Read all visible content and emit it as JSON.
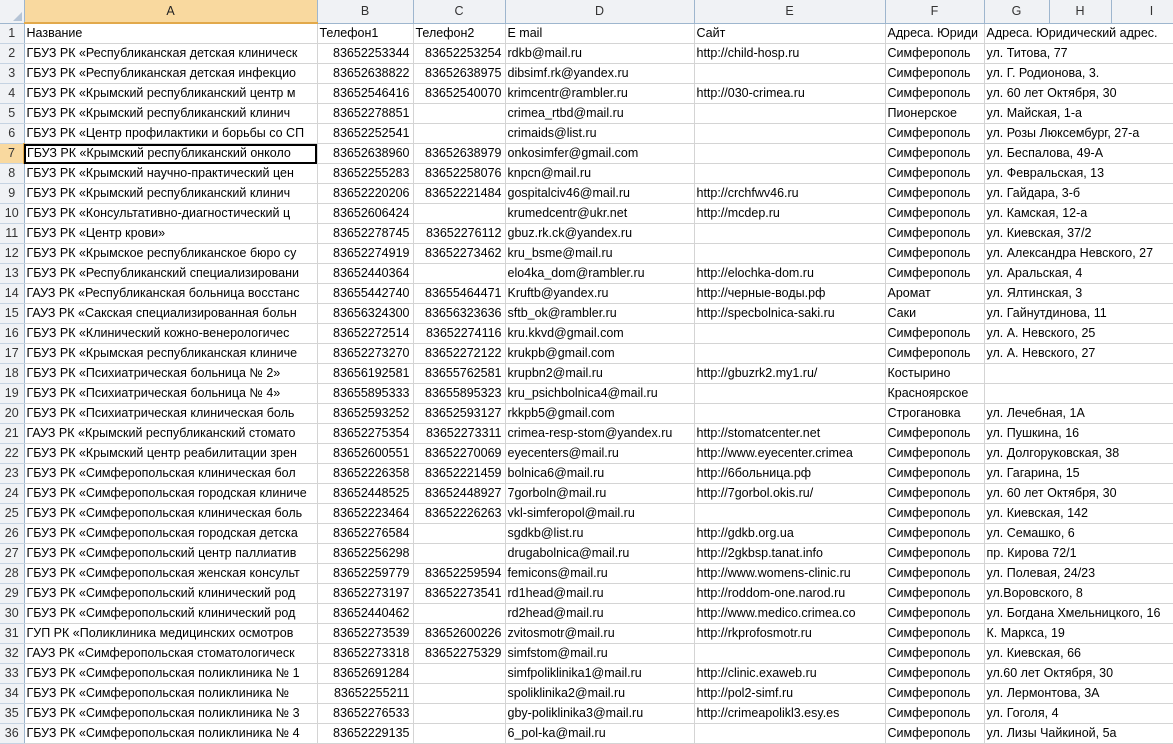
{
  "columns": [
    "A",
    "B",
    "C",
    "D",
    "E",
    "F",
    "G",
    "H",
    "I"
  ],
  "selected": {
    "row": 7,
    "col": "A"
  },
  "header_row": [
    "Название",
    "Телефон1",
    "Телефон2",
    "E mail",
    "Сайт",
    "Адреса. Юриди",
    "Адреса. Юридический адрес.",
    "",
    ""
  ],
  "rows": [
    [
      "ГБУЗ РК «Республиканская детская клиническ",
      "83652253344",
      "83652253254",
      "rdkb@mail.ru",
      "http://child-hosp.ru",
      "Симферополь",
      "ул. Титова, 77"
    ],
    [
      "ГБУЗ РК «Республиканская детская инфекцио",
      "83652638822",
      "83652638975",
      "dibsimf.rk@yandex.ru",
      "",
      "Симферополь",
      "ул. Г. Родионова, 3."
    ],
    [
      "ГБУЗ РК «Крымский республиканский центр м",
      "83652546416",
      "83652540070",
      "krimcentr@rambler.ru",
      "http://030-crimea.ru",
      "Симферополь",
      "ул. 60 лет Октября, 30"
    ],
    [
      " ГБУЗ РК «Крымский республиканский клинич",
      "83652278851",
      "",
      "crimea_rtbd@mail.ru",
      "",
      "Пионерское",
      "ул. Майская, 1-а"
    ],
    [
      "ГБУЗ РК «Центр профилактики и борьбы со СП",
      "83652252541",
      "",
      "crimaids@list.ru",
      "",
      "Симферополь",
      "ул. Розы Люксембург, 27-а"
    ],
    [
      "ГБУЗ РК «Крымский республиканский онколо",
      "83652638960",
      "83652638979",
      "onkosimfer@gmail.com",
      "",
      "Симферополь",
      " ул. Беспалова, 49-А"
    ],
    [
      "ГБУЗ РК «Крымский научно-практический цен",
      "83652255283",
      "83652258076",
      "knpcn@mail.ru",
      "",
      "Симферополь",
      "ул. Февральская, 13"
    ],
    [
      "ГБУЗ РК «Крымский республиканский клинич",
      "83652220206",
      "83652221484",
      "gospitalciv46@mail.ru",
      "http://crchfwv46.ru",
      "Симферополь",
      "ул. Гайдара, 3-б"
    ],
    [
      " ГБУЗ РК «Консультативно-диагностический ц",
      "83652606424",
      "",
      "krumedcentr@ukr.net",
      "http://mcdep.ru",
      "Симферополь",
      "ул. Камская, 12-а"
    ],
    [
      "ГБУЗ РК «Центр крови»",
      "83652278745",
      "83652276112",
      "gbuz.rk.ck@yandex.ru",
      "",
      "Симферополь",
      "ул. Киевская, 37/2"
    ],
    [
      "ГБУЗ РК «Крымское республиканское бюро су",
      "83652274919",
      "83652273462",
      "kru_bsme@mail.ru",
      "",
      "Симферополь",
      "ул. Александра Невского, 27"
    ],
    [
      "ГБУЗ РК «Республиканский специализировани",
      "83652440364",
      "",
      "elo4ka_dom@rambler.ru",
      "http://elochka-dom.ru",
      "Симферополь",
      "ул. Аральская, 4"
    ],
    [
      "ГАУЗ РК «Республиканская больница восстанс",
      "83655442740",
      "83655464471",
      "Kruftb@yandex.ru",
      "http://черные-воды.рф",
      "Аромат",
      "ул. Ялтинская, 3"
    ],
    [
      "ГАУЗ РК «Сакская специализированная больн",
      "83656324300",
      "83656323636",
      "sftb_ok@rambler.ru",
      "http://specbolnica-saki.ru",
      "Саки",
      "ул. Гайнутдинова, 11"
    ],
    [
      "ГБУЗ РК «Клинический кожно-венерологичес",
      "83652272514",
      "83652274116",
      "kru.kkvd@gmail.com",
      "",
      "Симферополь",
      "ул. А. Невского, 25"
    ],
    [
      "ГБУЗ РК «Крымская республиканская клиниче",
      "83652273270",
      "83652272122",
      "krukpb@gmail.com",
      "",
      "Симферополь",
      " ул. А. Невского, 27"
    ],
    [
      "ГБУЗ РК «Психиатрическая больница № 2»",
      "83656192581",
      "83655762581",
      "krupbn2@mail.ru",
      " http://gbuzrk2.my1.ru/",
      "Костырино",
      ""
    ],
    [
      "ГБУЗ РК «Психиатрическая больница № 4»",
      "83655895333",
      "83655895323",
      "kru_psichbolnica4@mail.ru",
      "",
      "Красноярское",
      ""
    ],
    [
      "ГБУЗ РК «Психиатрическая клиническая боль",
      "83652593252",
      "83652593127",
      "rkkpb5@gmail.com",
      "",
      "Строгановка",
      " ул. Лечебная, 1А"
    ],
    [
      "ГАУЗ РК «Крымский республиканский стомато",
      "83652275354",
      "83652273311",
      "crimea-resp-stom@yandex.ru",
      "http://stomatcenter.net",
      "Симферополь",
      "ул. Пушкина, 16"
    ],
    [
      "ГБУЗ РК «Крымский центр реабилитации зрен",
      "83652600551",
      "83652270069",
      " eyecenters@mail.ru",
      "http://www.eyecenter.crimea",
      "Симферополь",
      "ул. Долгоруковская, 38"
    ],
    [
      " ГБУЗ РК «Симферопольская клиническая бол",
      "83652226358",
      "83652221459",
      "bolnica6@mail.ru",
      "http://6больница.рф",
      "Симферополь",
      "ул. Гагарина, 15"
    ],
    [
      "ГБУЗ РК «Симферопольская городская клиниче",
      "83652448525",
      "83652448927",
      " 7gorboln@mail.ru",
      "http://7gorbol.okis.ru/",
      "Симферополь",
      "ул. 60 лет Октября, 30"
    ],
    [
      "ГБУЗ РК «Симферопольская клиническая боль",
      "83652223464",
      "83652226263",
      "vkl-simferopol@mail.ru",
      "",
      "Симферополь",
      "ул. Киевская, 142"
    ],
    [
      "ГБУЗ РК «Симферопольская городская детска",
      "83652276584",
      "",
      "sgdkb@list.ru",
      "http://gdkb.org.ua",
      "Симферополь",
      "ул. Семашко, 6"
    ],
    [
      "ГБУЗ РК «Симферопольский центр паллиатив",
      "83652256298",
      "",
      " drugabolnica@mail.ru",
      "http://2gkbsp.tanat.info",
      "Симферополь",
      "пр. Кирова 72/1"
    ],
    [
      "ГБУЗ РК «Симферопольская женская консульт",
      "83652259779",
      "83652259594",
      "femicons@mail.ru",
      "http://www.womens-clinic.ru",
      "Симферополь",
      "ул. Полевая, 24/23"
    ],
    [
      "ГБУЗ РК «Симферопольский клинический род",
      "83652273197",
      "83652273541",
      "rd1head@mail.ru",
      "http://roddom-one.narod.ru",
      "Симферополь",
      "ул.Воровского, 8"
    ],
    [
      "ГБУЗ РК «Симферопольский клинический род",
      "83652440462",
      "",
      " rd2head@mail.ru",
      "http://www.medico.crimea.co",
      "Симферополь",
      "ул. Богдана Хмельницкого, 16"
    ],
    [
      "ГУП РК «Поликлиника медицинских осмотров",
      "83652273539",
      "83652600226",
      "zvitosmotr@mail.ru",
      "http://rkprofosmotr.ru",
      "Симферополь",
      "К. Маркса, 19"
    ],
    [
      "ГАУЗ РК «Симферопольская стоматологическ",
      "83652273318",
      "83652275329",
      "simfstom@mail.ru",
      "",
      "Симферополь",
      "ул. Киевская, 66"
    ],
    [
      "ГБУЗ РК «Симферопольская поликлиника № 1",
      "83652691284",
      "",
      "simfpoliklinika1@mail.ru",
      "http://clinic.exaweb.ru",
      "Симферополь",
      "ул.60 лет Октября, 30"
    ],
    [
      " ГБУЗ РК «Симферопольская поликлиника №",
      "83652255211",
      "",
      "spoliklinika2@mail.ru",
      "http://pol2-simf.ru",
      "Симферополь",
      " ул. Лермонтова, 3А"
    ],
    [
      "ГБУЗ РК «Симферопольская поликлиника № 3",
      "83652276533",
      "",
      "gby-poliklinika3@mail.ru",
      "http://crimeapolikl3.esy.es",
      "Симферополь",
      " ул. Гоголя, 4"
    ],
    [
      "ГБУЗ РК «Симферопольская поликлиника № 4",
      "83652229135",
      "",
      " 6_pol-ka@mail.ru",
      "",
      "Симферополь",
      "ул. Лизы Чайкиной, 5а"
    ]
  ]
}
